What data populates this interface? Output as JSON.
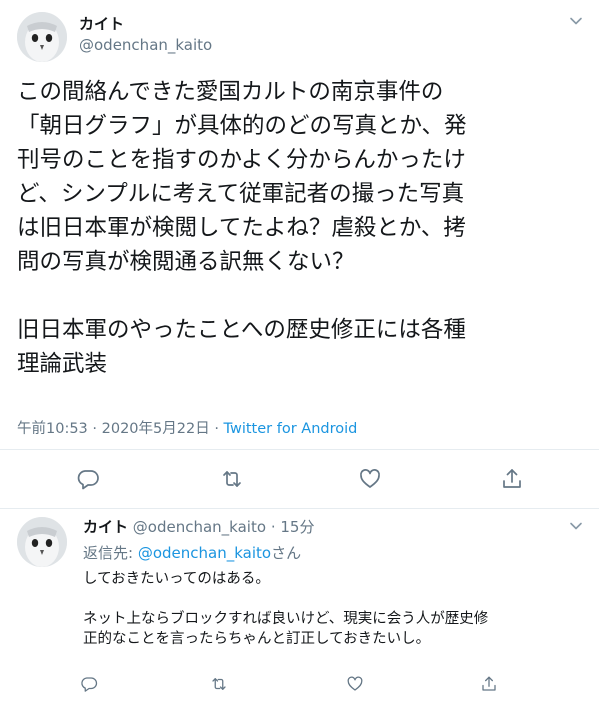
{
  "tweet": {
    "display_name": "カイト",
    "handle": "@odenchan_kaito",
    "text": "この間絡んできた愛国カルトの南京事件の\n「朝日グラフ」が具体的のどの写真とか、発\n刊号のことを指すのかよく分からんかったけ\nど、シンプルに考えて従軍記者の撮った写真\nは旧日本軍が検閲してたよね？虐殺とか、拷\n問の写真が検閲通る訳無くない？\n\n旧日本軍のやったことへの歴史修正には各種\n理論武装",
    "time": "午前10:53",
    "sep1": "·",
    "date": "2020年5月22日",
    "sep2": "·",
    "source": "Twitter for Android"
  },
  "reply": {
    "display_name": "カイト",
    "handle": "@odenchan_kaito",
    "sep": "·",
    "age": "15分",
    "reply_prefix": "返信先: ",
    "reply_handle": "@odenchan_kaito",
    "reply_suffix": "さん",
    "text": "しておきたいってのはある。\n\nネット上ならブロックすれば良いけど、現実に会う人が歴史修\n正的なことを言ったらちゃんと訂正しておきたいし。"
  },
  "icons": [
    "chevron-down-icon",
    "reply-icon",
    "retweet-icon",
    "like-icon",
    "share-icon",
    "owl-avatar"
  ],
  "colors": {
    "link": "#1b95e0",
    "muted": "#657786",
    "text": "#14171a",
    "divider": "#e6ecf0"
  }
}
